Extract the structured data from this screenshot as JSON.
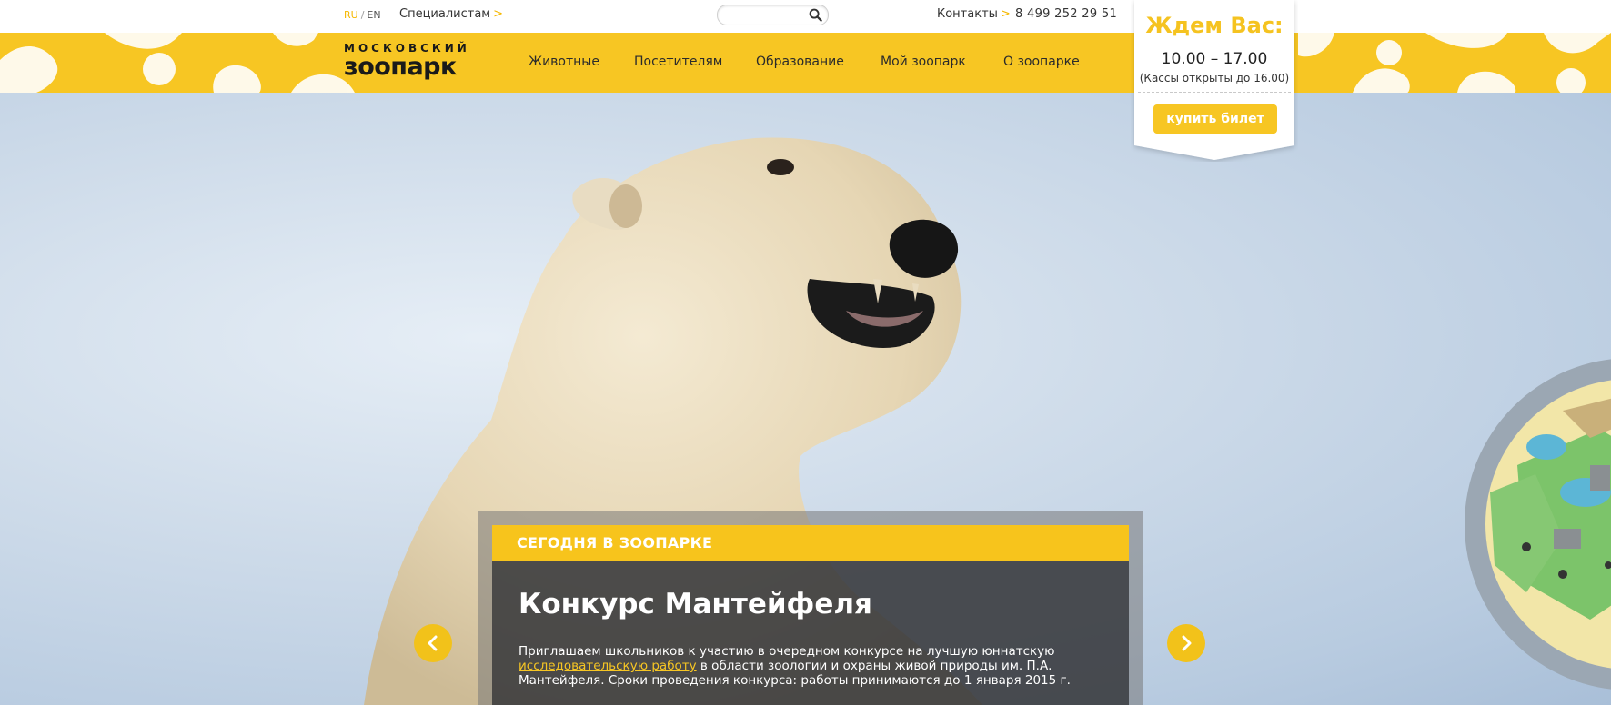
{
  "header": {
    "lang_ru": "RU",
    "lang_sep": "/",
    "lang_en": "EN",
    "specialists": "Специалистам",
    "contacts": "Контакты",
    "phone": "8 499 252 29 51",
    "chevron": ">"
  },
  "logo": {
    "line1": "МОСКОВСКИЙ",
    "line2": "зоопарк"
  },
  "nav": {
    "items": [
      "Животные",
      "Посетителям",
      "Образование",
      "Мой зоопарк",
      "О зоопарке"
    ]
  },
  "schedule": {
    "title": "Ждем Вас:",
    "hours": "10.00 – 17.00",
    "note": "(Кассы открыты до 16.00)",
    "buy_button": "купить билет"
  },
  "today": {
    "header": "СЕГОДНЯ В ЗООПАРКЕ",
    "title": "Конкурс Мантейфеля",
    "text_before_link": "Приглашаем школьников к участию в очередном конкурсе на лучшую юннатскую ",
    "link_text": "исследовательскую работу",
    "text_after_link": " в области зоологии и охраны живой природы им. П.А. Мантейфеля. Сроки проведения конкурса: работы принимаются до 1 января 2015 г."
  },
  "colors": {
    "brand_yellow": "#f7c623",
    "text_dark": "#2b2b2b"
  },
  "icons": {
    "search": "search-icon",
    "prev": "chevron-left-icon",
    "next": "chevron-right-icon"
  }
}
